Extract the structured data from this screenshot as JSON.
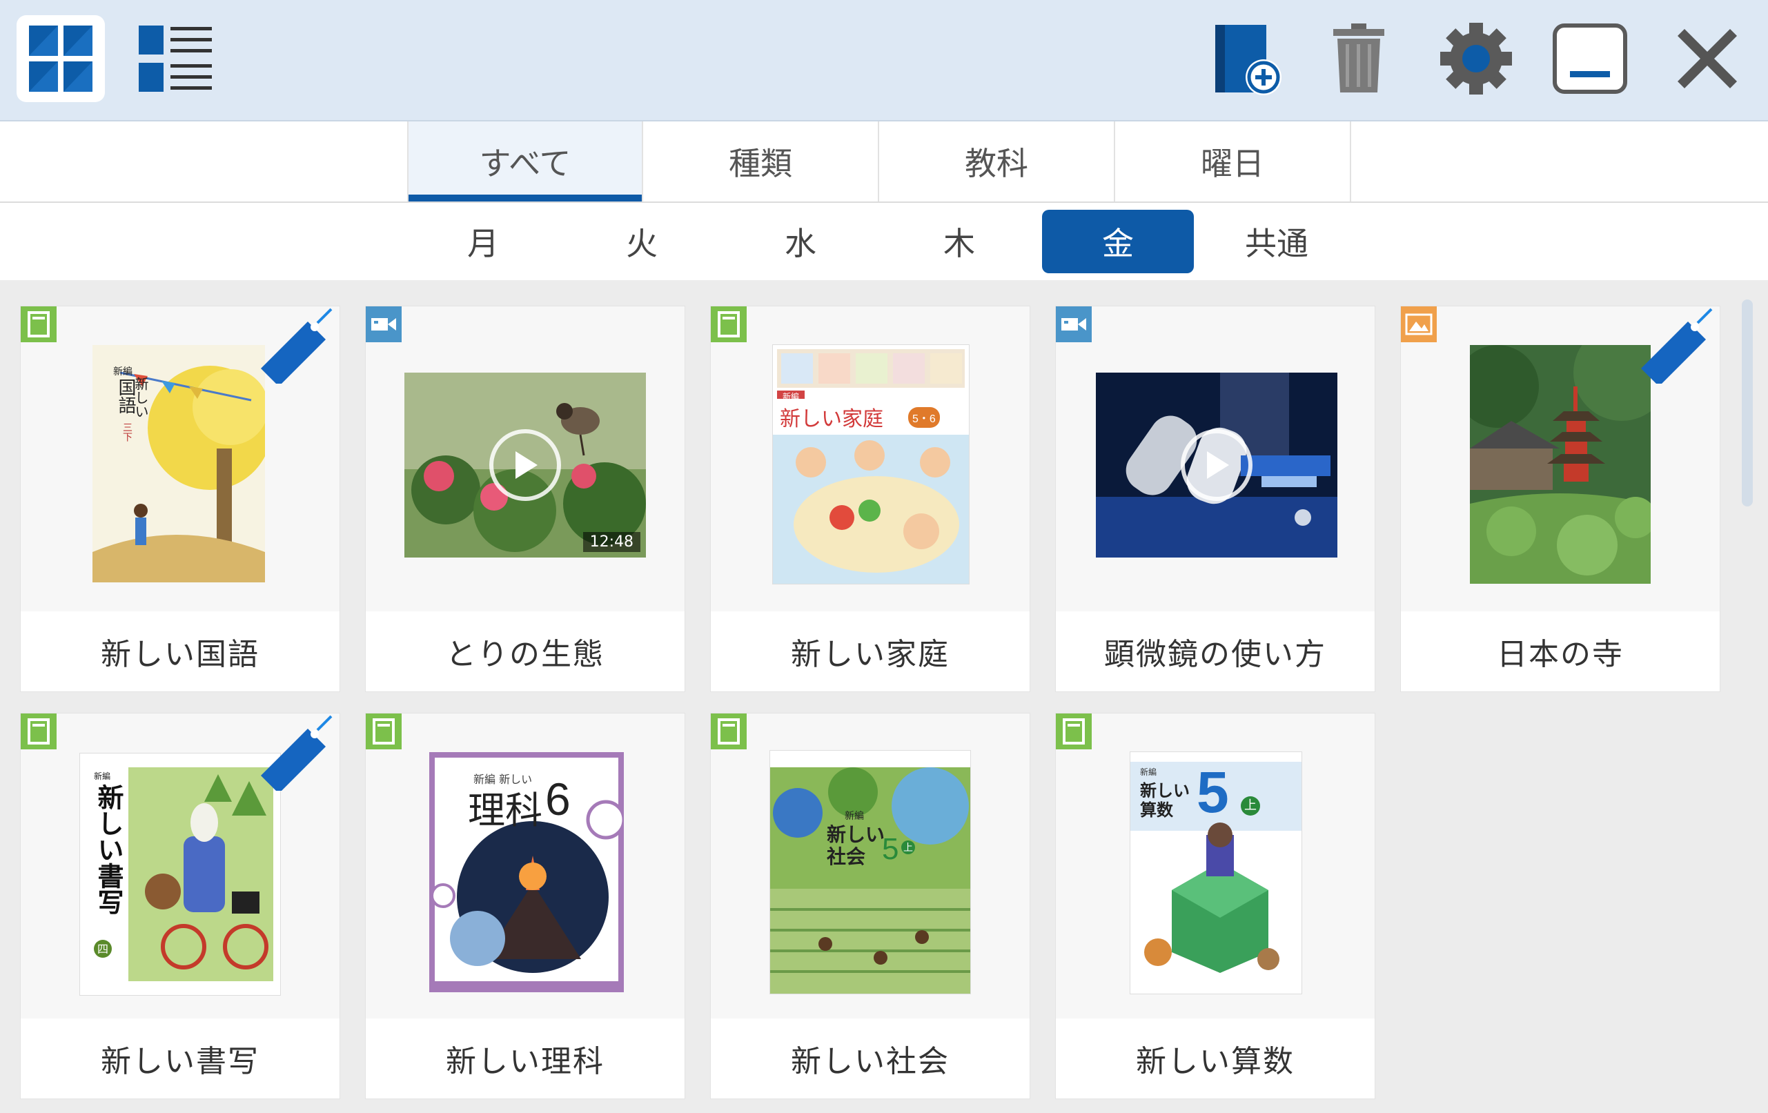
{
  "toolbar": {
    "buttons": [
      {
        "icon": "grid-view-icon"
      },
      {
        "icon": "list-view-icon"
      },
      {
        "icon": "add-book-icon"
      },
      {
        "icon": "trash-icon"
      },
      {
        "icon": "gear-icon"
      },
      {
        "icon": "minimize-icon"
      },
      {
        "icon": "close-icon"
      }
    ]
  },
  "tabs": [
    {
      "label": "すべて",
      "active": true
    },
    {
      "label": "種類",
      "active": false
    },
    {
      "label": "教科",
      "active": false
    },
    {
      "label": "曜日",
      "active": false
    }
  ],
  "days": [
    {
      "label": "月",
      "active": false
    },
    {
      "label": "火",
      "active": false
    },
    {
      "label": "水",
      "active": false
    },
    {
      "label": "木",
      "active": false
    },
    {
      "label": "金",
      "active": true
    },
    {
      "label": "共通",
      "active": false
    }
  ],
  "items": [
    {
      "title": "新しい国語",
      "type": "book",
      "bookmarked": true
    },
    {
      "title": "とりの生態",
      "type": "video",
      "bookmarked": false,
      "duration": "12:48"
    },
    {
      "title": "新しい家庭",
      "type": "book",
      "bookmarked": false
    },
    {
      "title": "顕微鏡の使い方",
      "type": "video",
      "bookmarked": false
    },
    {
      "title": "日本の寺",
      "type": "image",
      "bookmarked": true
    },
    {
      "title": "新しい書写",
      "type": "book",
      "bookmarked": true
    },
    {
      "title": "新しい理科",
      "type": "book",
      "bookmarked": false
    },
    {
      "title": "新しい社会",
      "type": "book",
      "bookmarked": false
    },
    {
      "title": "新しい算数",
      "type": "book",
      "bookmarked": false
    }
  ],
  "covers": {
    "kokugo": {
      "small": "新編",
      "main": "新しい",
      "sub": "国語",
      "vol": "三下"
    },
    "katei": {
      "small": "新編",
      "main": "新しい家庭",
      "grade": "5・6"
    },
    "shosha": {
      "small": "新編",
      "main": "新しい書写",
      "vol": "四"
    },
    "rika": {
      "small": "新編 新しい",
      "main": "理科",
      "grade": "6"
    },
    "shakai": {
      "small": "新編",
      "main": "新しい",
      "sub": "社会",
      "grade": "5",
      "vol": "上"
    },
    "sansu": {
      "small": "新編",
      "main": "新しい",
      "sub": "算数",
      "grade": "5",
      "vol": "上"
    }
  },
  "colors": {
    "accent": "#0e5aa7",
    "toolbar_bg": "#dde8f4",
    "book_badge": "#7cc04b",
    "video_badge": "#4a95c9",
    "image_badge": "#f0a04b"
  }
}
